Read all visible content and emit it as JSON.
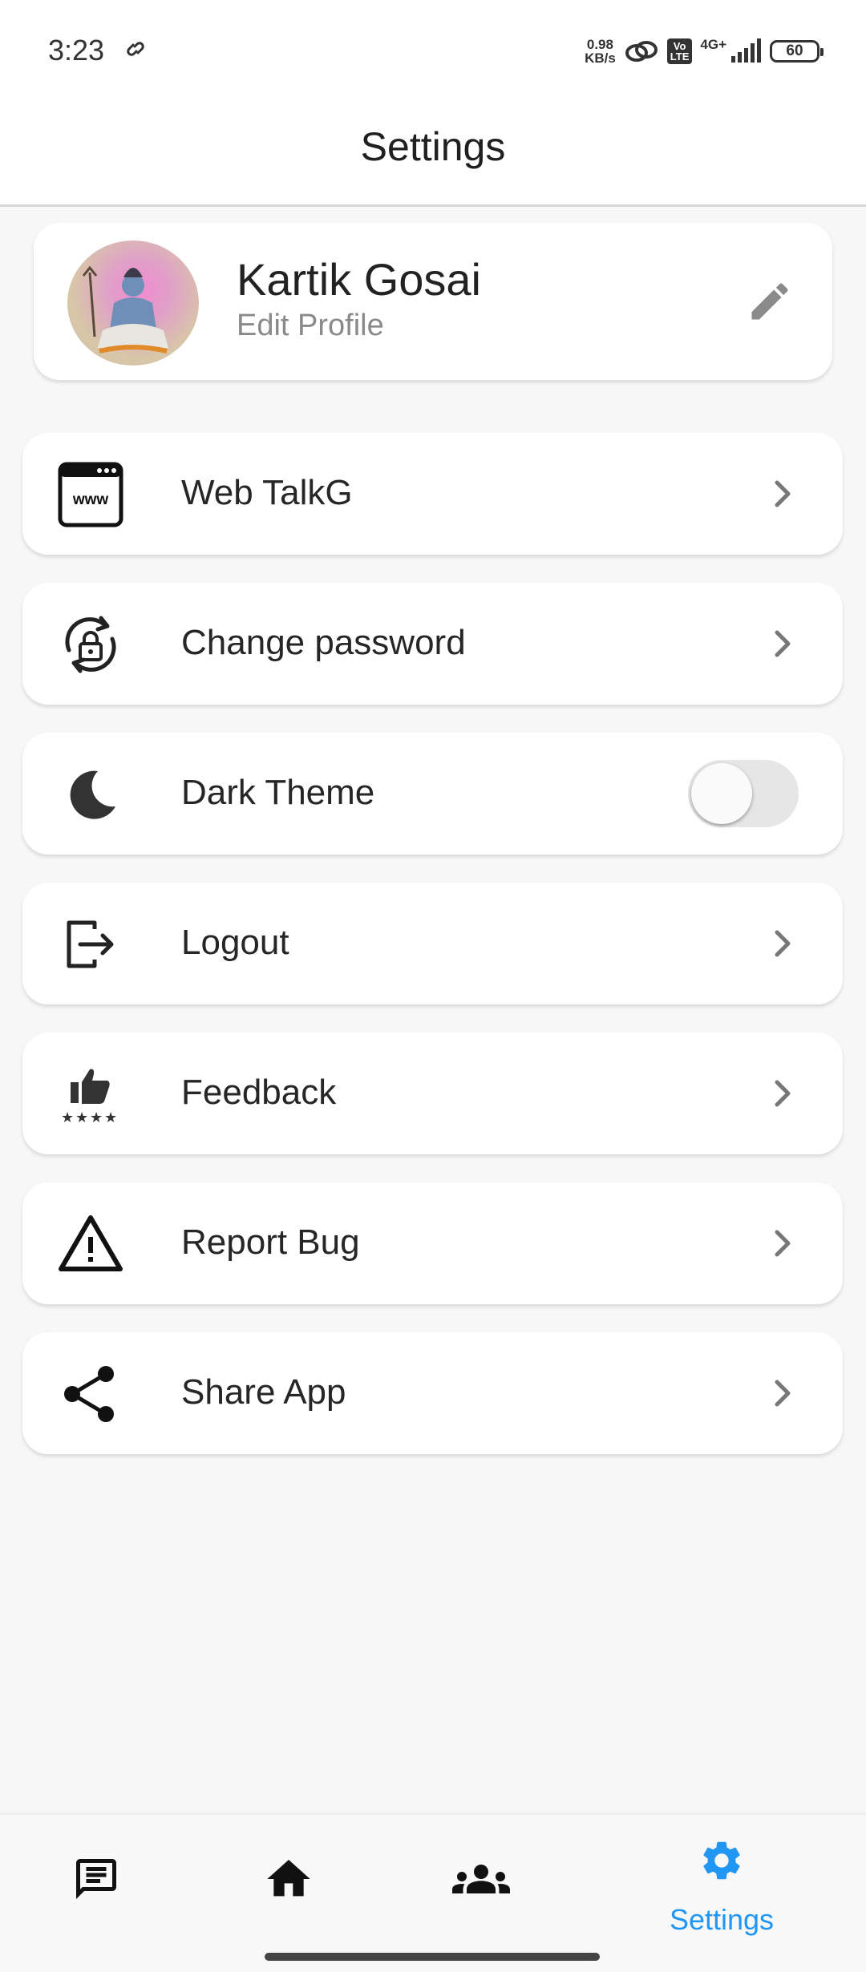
{
  "status_bar": {
    "time": "3:23",
    "net_speed_value": "0.98",
    "net_speed_unit": "KB/s",
    "volte_top": "Vo",
    "volte_bottom": "LTE",
    "network": "4G+",
    "battery": "60"
  },
  "app_bar": {
    "title": "Settings"
  },
  "profile": {
    "name": "Kartik Gosai",
    "subtitle": "Edit Profile"
  },
  "menu": {
    "items": [
      {
        "label": "Web TalkG",
        "icon": "www-icon"
      },
      {
        "label": "Change password",
        "icon": "lock-refresh-icon"
      },
      {
        "label": "Dark Theme",
        "icon": "moon-icon",
        "toggle": false
      },
      {
        "label": "Logout",
        "icon": "logout-icon"
      },
      {
        "label": "Feedback",
        "icon": "thumbs-up-stars-icon"
      },
      {
        "label": "Report Bug",
        "icon": "warning-icon"
      },
      {
        "label": "Share App",
        "icon": "share-icon"
      }
    ]
  },
  "bottom_nav": {
    "items": [
      {
        "icon": "chat-icon"
      },
      {
        "icon": "home-icon"
      },
      {
        "icon": "group-icon"
      },
      {
        "icon": "gear-icon",
        "label": "Settings",
        "active": true
      }
    ],
    "active_color": "#2196f3"
  }
}
